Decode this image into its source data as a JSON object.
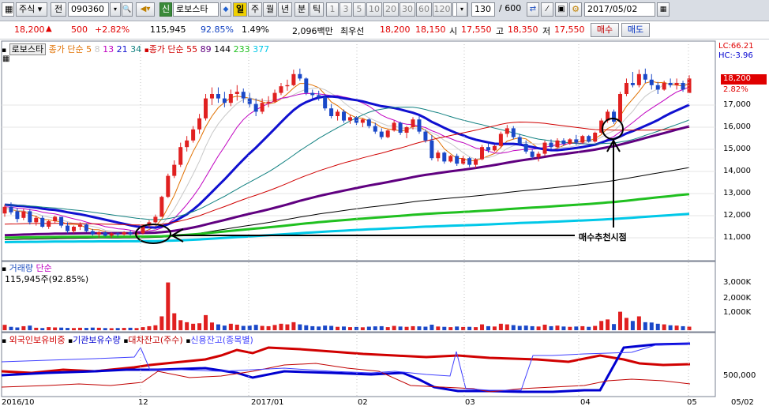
{
  "toolbar": {
    "type": "주식",
    "prefix": "전",
    "code": "090360",
    "tag": "신",
    "name": "로보스타",
    "periods": [
      "일",
      "주",
      "월",
      "년",
      "분",
      "틱"
    ],
    "numbers": [
      "1",
      "3",
      "5",
      "10",
      "20",
      "30",
      "60",
      "120"
    ],
    "count": "130",
    "count_total": "/ 600",
    "date": "2017/05/02"
  },
  "quote": {
    "price": "18,200",
    "change": "500",
    "change_pct": "+2.82%",
    "volume": "115,945",
    "volume_pct": "92.85%",
    "turnover": "1.49%",
    "amount": "2,096백만",
    "bid_label": "최우선",
    "ask": "18,200",
    "bid": "18,150",
    "open_label": "시",
    "open": "17,550",
    "high_label": "고",
    "high": "18,350",
    "low_label": "저",
    "low": "17,550",
    "buy": "매수",
    "sell": "매도"
  },
  "main_chart": {
    "stock": "로보스타",
    "ma_group1_label": "종가 단순",
    "ma_group1": [
      {
        "period": "5",
        "color": "#e07000"
      },
      {
        "period": "8",
        "color": "#c8c8c8"
      },
      {
        "period": "13",
        "color": "#c000c0"
      },
      {
        "period": "21",
        "color": "#1010d0"
      },
      {
        "period": "34",
        "color": "#108080"
      }
    ],
    "ma_group2_label": "종가 단순",
    "ma_group2": [
      {
        "period": "55",
        "color": "#d00000"
      },
      {
        "period": "89",
        "color": "#600080"
      },
      {
        "period": "144",
        "color": "#000000"
      },
      {
        "period": "233",
        "color": "#20c020"
      },
      {
        "period": "377",
        "color": "#00c8e8"
      }
    ],
    "annotation": "매수추천시점",
    "lc": "LC:66.21",
    "hc": "HC:-3.96",
    "price_tag": "18,200",
    "pct_tag": "2.82%",
    "yticks": [
      "17,000",
      "16,000",
      "15,000",
      "14,000",
      "13,000",
      "12,000",
      "11,000"
    ]
  },
  "volume_panel": {
    "title": "거래량",
    "mode": "단순",
    "value": "115,945주(92.85%)",
    "yticks": [
      "3,000K",
      "2,000K",
      "1,000K"
    ]
  },
  "holding_panel": {
    "legend": [
      {
        "label": "외국인보유비중",
        "color": "#d00000"
      },
      {
        "label": "기관보유수량",
        "color": "#0000d0"
      },
      {
        "label": "대차잔고(주수)",
        "color": "#c00000"
      },
      {
        "label": "신용잔고(종목별)",
        "color": "#4040ff"
      }
    ],
    "ytick": "500,000"
  },
  "xaxis": [
    "2016/10",
    "12",
    "2017/01",
    "02",
    "03",
    "04",
    "05",
    "05/02"
  ],
  "chart_data": {
    "type": "candlestick",
    "title": "로보스타",
    "ylim": [
      10500,
      19200
    ],
    "candles_ohlc": [
      [
        12100,
        12500,
        11950,
        12400
      ],
      [
        12400,
        12600,
        12050,
        12150
      ],
      [
        12200,
        12350,
        11700,
        11850
      ],
      [
        11900,
        12300,
        11800,
        12200
      ],
      [
        12200,
        12300,
        11600,
        11700
      ],
      [
        11700,
        12000,
        11550,
        11900
      ],
      [
        11900,
        12000,
        11450,
        11500
      ],
      [
        11500,
        11800,
        11400,
        11750
      ],
      [
        11750,
        12000,
        11650,
        11950
      ],
      [
        11950,
        11950,
        11450,
        11550
      ],
      [
        11550,
        11700,
        11200,
        11300
      ],
      [
        11300,
        11550,
        11200,
        11500
      ],
      [
        11500,
        11700,
        11350,
        11600
      ],
      [
        11600,
        11650,
        11250,
        11300
      ],
      [
        11300,
        11400,
        11100,
        11150
      ],
      [
        11150,
        11300,
        11000,
        11250
      ],
      [
        11250,
        11300,
        11050,
        11100
      ],
      [
        11100,
        11250,
        11000,
        11200
      ],
      [
        11200,
        11250,
        11050,
        11150
      ],
      [
        11150,
        11300,
        11100,
        11250
      ],
      [
        11250,
        11350,
        11100,
        11150
      ],
      [
        11150,
        11250,
        11050,
        11200
      ],
      [
        11200,
        11600,
        11150,
        11550
      ],
      [
        11550,
        11800,
        11450,
        11700
      ],
      [
        11700,
        12050,
        11650,
        11950
      ],
      [
        11950,
        12900,
        11950,
        12850
      ],
      [
        12850,
        13900,
        12800,
        13800
      ],
      [
        13800,
        14500,
        13700,
        14300
      ],
      [
        14300,
        15300,
        14200,
        15100
      ],
      [
        15100,
        15600,
        14900,
        15400
      ],
      [
        15400,
        16050,
        15300,
        15900
      ],
      [
        15900,
        16600,
        15700,
        16400
      ],
      [
        16400,
        17500,
        16300,
        17300
      ],
      [
        17300,
        17800,
        17000,
        17500
      ],
      [
        17500,
        17800,
        17100,
        17300
      ],
      [
        17300,
        17600,
        16900,
        17100
      ],
      [
        17100,
        17700,
        16950,
        17500
      ],
      [
        17500,
        17900,
        17200,
        17600
      ],
      [
        17600,
        17750,
        17100,
        17300
      ],
      [
        17300,
        17550,
        16900,
        17050
      ],
      [
        17050,
        17300,
        16500,
        16700
      ],
      [
        16700,
        17300,
        16600,
        17100
      ],
      [
        17100,
        17400,
        16900,
        17150
      ],
      [
        17150,
        17700,
        17100,
        17550
      ],
      [
        17550,
        18000,
        17450,
        17850
      ],
      [
        17850,
        18150,
        17650,
        17900
      ],
      [
        17900,
        18600,
        17850,
        18400
      ],
      [
        18400,
        18650,
        18100,
        18200
      ],
      [
        18200,
        18250,
        17450,
        17550
      ],
      [
        17550,
        17700,
        17300,
        17450
      ],
      [
        17450,
        17650,
        17200,
        17350
      ],
      [
        17350,
        17500,
        16750,
        16850
      ],
      [
        16850,
        17050,
        16400,
        16500
      ],
      [
        16500,
        16800,
        16300,
        16700
      ],
      [
        16700,
        16800,
        16200,
        16300
      ],
      [
        16300,
        16550,
        16150,
        16450
      ],
      [
        16450,
        16500,
        16100,
        16200
      ],
      [
        16200,
        16400,
        16000,
        16350
      ],
      [
        16350,
        16400,
        15950,
        16050
      ],
      [
        16050,
        16200,
        15700,
        15800
      ],
      [
        15800,
        15950,
        15450,
        15550
      ],
      [
        15550,
        15900,
        15500,
        15850
      ],
      [
        15850,
        16300,
        15800,
        16200
      ],
      [
        16200,
        16250,
        15650,
        15750
      ],
      [
        15750,
        16050,
        15500,
        16000
      ],
      [
        16000,
        16450,
        15900,
        16350
      ],
      [
        16350,
        16500,
        15700,
        15800
      ],
      [
        15800,
        15900,
        15300,
        15400
      ],
      [
        15400,
        15650,
        14500,
        14600
      ],
      [
        14600,
        14950,
        14450,
        14850
      ],
      [
        14850,
        14900,
        14350,
        14450
      ],
      [
        14450,
        14750,
        14400,
        14700
      ],
      [
        14700,
        14800,
        14250,
        14350
      ],
      [
        14350,
        14700,
        14300,
        14600
      ],
      [
        14600,
        14650,
        14200,
        14300
      ],
      [
        14300,
        14600,
        14150,
        14550
      ],
      [
        14550,
        15200,
        14500,
        15100
      ],
      [
        15100,
        15300,
        14850,
        14950
      ],
      [
        14950,
        15200,
        14900,
        15150
      ],
      [
        15150,
        15800,
        15050,
        15700
      ],
      [
        15700,
        16100,
        15550,
        15950
      ],
      [
        15950,
        16050,
        15450,
        15550
      ],
      [
        15550,
        15700,
        15150,
        15250
      ],
      [
        15250,
        15400,
        14800,
        14900
      ],
      [
        14900,
        15000,
        14550,
        14650
      ],
      [
        14650,
        14900,
        14450,
        14800
      ],
      [
        14800,
        15400,
        14700,
        15300
      ],
      [
        15300,
        15450,
        15000,
        15100
      ],
      [
        15100,
        15500,
        15050,
        15400
      ],
      [
        15400,
        15500,
        15150,
        15250
      ],
      [
        15250,
        15500,
        15200,
        15450
      ],
      [
        15450,
        15650,
        15200,
        15300
      ],
      [
        15300,
        15650,
        15250,
        15600
      ],
      [
        15600,
        15650,
        15300,
        15350
      ],
      [
        15350,
        15800,
        15300,
        15750
      ],
      [
        15750,
        16400,
        15700,
        16300
      ],
      [
        16300,
        16800,
        16200,
        16700
      ],
      [
        16700,
        16800,
        16150,
        16250
      ],
      [
        16250,
        17600,
        16200,
        17500
      ],
      [
        17500,
        18200,
        17400,
        18000
      ],
      [
        18000,
        18500,
        17800,
        17900
      ],
      [
        17900,
        18600,
        17800,
        18400
      ],
      [
        18400,
        18650,
        18000,
        18150
      ],
      [
        18150,
        18400,
        17700,
        17900
      ],
      [
        17900,
        18050,
        17500,
        17700
      ],
      [
        17700,
        18100,
        17650,
        18000
      ],
      [
        18000,
        18200,
        17800,
        17900
      ],
      [
        17900,
        18200,
        17700,
        18000
      ],
      [
        18000,
        18100,
        17600,
        17700
      ],
      [
        17550,
        18350,
        17550,
        18200
      ]
    ],
    "volume_k": [
      350,
      220,
      180,
      260,
      300,
      160,
      140,
      200,
      180,
      170,
      150,
      140,
      160,
      150,
      170,
      160,
      140,
      130,
      140,
      150,
      160,
      140,
      200,
      260,
      320,
      900,
      3100,
      1100,
      650,
      520,
      420,
      450,
      980,
      500,
      380,
      300,
      420,
      360,
      280,
      300,
      350,
      280,
      260,
      340,
      420,
      380,
      520,
      380,
      320,
      260,
      240,
      300,
      280,
      220,
      240,
      200,
      210,
      190,
      230,
      250,
      260,
      200,
      280,
      240,
      220,
      260,
      250,
      230,
      360,
      240,
      220,
      200,
      240,
      210,
      220,
      200,
      380,
      260,
      240,
      420,
      380,
      330,
      280,
      300,
      260,
      240,
      360,
      260,
      300,
      240,
      220,
      240,
      260,
      220,
      280,
      600,
      700,
      400,
      1200,
      800,
      600,
      900,
      520,
      500,
      420,
      380,
      320,
      300,
      260,
      230
    ]
  }
}
